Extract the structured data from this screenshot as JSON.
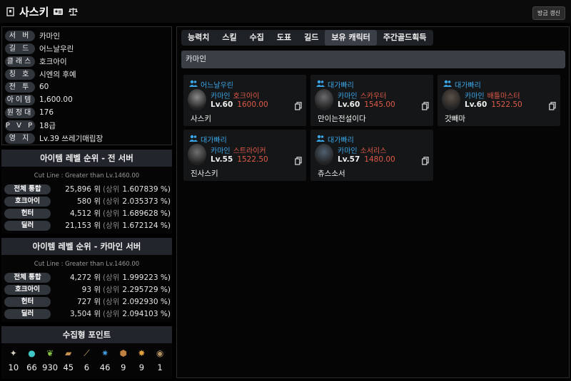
{
  "header": {
    "title": "사스키",
    "refresh_label": "방금 갱신"
  },
  "profile": [
    {
      "label": "서 버",
      "value": "카마인"
    },
    {
      "label": "길 드",
      "value": "어느날우린"
    },
    {
      "label": "클래스",
      "value": "호크아이"
    },
    {
      "label": "칭 호",
      "value": "시엔의 후예"
    },
    {
      "label": "전 투",
      "value": "60"
    },
    {
      "label": "아이템",
      "value": "1,600.00"
    },
    {
      "label": "원정대",
      "value": "176"
    },
    {
      "label": "P V P",
      "value": "18급"
    },
    {
      "label": "영 지",
      "value": "Lv.39 쓰레기매립장"
    }
  ],
  "rank_all": {
    "title": "아이템 레벨 순위 - 전 서버",
    "cutline": "Cut Line : Greater than Lv.1460.00",
    "rows": [
      {
        "label": "전체 통합",
        "rank": "25,896 위",
        "sub": "(상위",
        "pct": "1.607839 %)"
      },
      {
        "label": "호크아이",
        "rank": "580 위",
        "sub": "(상위",
        "pct": "2.035373 %)"
      },
      {
        "label": "헌터",
        "rank": "4,512 위",
        "sub": "(상위",
        "pct": "1.689628 %)"
      },
      {
        "label": "딜러",
        "rank": "21,153 위",
        "sub": "(상위",
        "pct": "1.672124 %)"
      }
    ]
  },
  "rank_server": {
    "title": "아이템 레벨 순위 - 카마인 서버",
    "cutline": "Cut Line : Greater than Lv.1460.00",
    "rows": [
      {
        "label": "전체 통합",
        "rank": "4,272 위",
        "sub": "(상위",
        "pct": "1.999223 %)"
      },
      {
        "label": "호크아이",
        "rank": "93 위",
        "sub": "(상위",
        "pct": "2.295729 %)"
      },
      {
        "label": "헌터",
        "rank": "727 위",
        "sub": "(상위",
        "pct": "2.092930 %)"
      },
      {
        "label": "딜러",
        "rank": "3,504 위",
        "sub": "(상위",
        "pct": "2.094103 %)"
      }
    ]
  },
  "collect": {
    "title": "수집형 포인트",
    "items": [
      {
        "icon": "mokoko-seed-icon",
        "value": "10",
        "color": "#d8d0c0"
      },
      {
        "icon": "island-heart-icon",
        "value": "66",
        "color": "#40c8c8"
      },
      {
        "icon": "giant-heart-icon",
        "value": "930",
        "color": "#8ac840"
      },
      {
        "icon": "art-icon",
        "value": "45",
        "color": "#c89050"
      },
      {
        "icon": "voyage-icon",
        "value": "6",
        "color": "#d8b070"
      },
      {
        "icon": "world-tree-leaf-icon",
        "value": "46",
        "color": "#40a0e0"
      },
      {
        "icon": "ignea-token-icon",
        "value": "9",
        "color": "#c08040"
      },
      {
        "icon": "orpheus-star-icon",
        "value": "9",
        "color": "#e0a040"
      },
      {
        "icon": "omnium-star-icon",
        "value": "1",
        "color": "#b09060"
      }
    ]
  },
  "tabs": [
    "능력치",
    "스킬",
    "수집",
    "도표",
    "길드",
    "보유 캐릭터",
    "주간골드획득"
  ],
  "active_tab": 5,
  "server_name": "카마인",
  "characters": [
    {
      "guild": "어느날우린",
      "server": "카마인",
      "class": "호크아이",
      "level": "Lv.60",
      "ilvl": "1600.00",
      "name": "사스키",
      "avatar": "#8a8a8a"
    },
    {
      "guild": "대가빠리",
      "server": "카마인",
      "class": "스카우터",
      "level": "Lv.60",
      "ilvl": "1545.00",
      "name": "만이는전설이다",
      "avatar": "#6a6a70"
    },
    {
      "guild": "대가빠리",
      "server": "카마인",
      "class": "배틀마스터",
      "level": "Lv.60",
      "ilvl": "1522.50",
      "name": "갓빼마",
      "avatar": "#5a5048"
    },
    {
      "guild": "대가빠리",
      "server": "카마인",
      "class": "스트라이커",
      "level": "Lv.55",
      "ilvl": "1522.50",
      "name": "진사스키",
      "avatar": "#707070"
    },
    {
      "guild": "대가빠리",
      "server": "카마인",
      "class": "소서리스",
      "level": "Lv.57",
      "ilvl": "1480.00",
      "name": "츄스소서",
      "avatar": "#506070"
    }
  ]
}
